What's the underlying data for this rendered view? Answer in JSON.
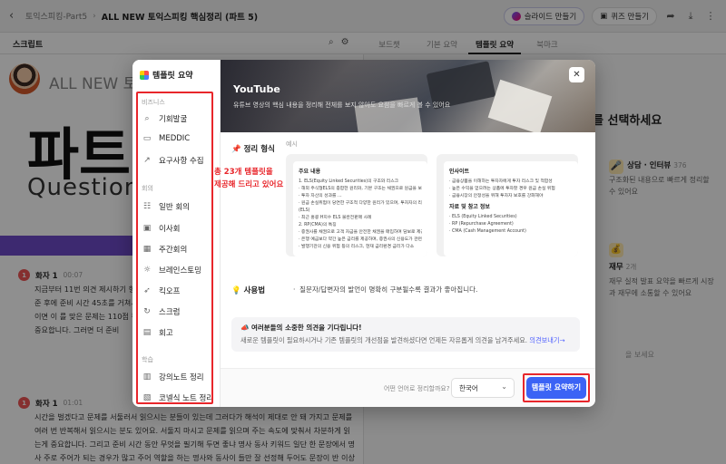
{
  "topbar": {
    "crumb": "토익스피킹-Part5",
    "title": "ALL NEW 토익스피킹 핵심정리 (파트 5)",
    "slide_btn": "슬라이드 만들기",
    "quiz_btn": "퀴즈 만들기"
  },
  "subbar": {
    "label": "스크립트",
    "tabs": [
      "보드챗",
      "기본 요약",
      "템플릿 요약",
      "북마크"
    ]
  },
  "left": {
    "hero_title": "ALL NEW 토익",
    "big_title": "파트",
    "subtitle": "Question",
    "blocks": [
      {
        "num": "1",
        "speaker": "화자 1",
        "time": "00:07",
        "text": "지금부터 11번 의견 제시하기 형식입니다. 이 문제는 간이 45초가 있고 답변 시간이 1분입니다. 45초가 준 후에 준비 시간 45초를 거쳐서 각을 잘 정해 나가셔야 돼요. 그러면 이하 이니면 내 실력이 130 이하이면 이 를 맞은 문제는 110점 뒤 100 과 문제를 준 그리고 주제가 문제가 집착 없이 곰히 해석하는게 중요합니다. 그러면 더 준비"
      },
      {
        "num": "1",
        "speaker": "화자 1",
        "time": "01:01",
        "text": "시간을 벌겠다고 문제를 서둘러서 읽으시는 분들이 있는데 그러다가 해석이 제대로 안 돼 가지고 문제를 여러 번 반복해서 읽으시는 분도 있어요. 서둘지 마시고 문제를 읽으며 주는 속도에 맞춰서 차분하게 읽는게 중요합니다. 그리고 준비 시간 동안 무엇을 필기해 두면 좋냐 명사 동사 키워드 일단 한 문장에서 명사 주로 주어가 되는 경우가 많고 주어 역할을 하는 명사와 동사이 들만 잘 선정해 두어도 문장이 반 이상은"
      }
    ]
  },
  "right": {
    "heading": "를 선택하세요",
    "cards": [
      {
        "icon": "🎤",
        "title": "상담 · 인터뷰",
        "count": "376",
        "desc": "구조화된 내용으로 빠르게 정리할 수 있어요"
      },
      {
        "icon": "💰",
        "title": "재무",
        "count": "2개",
        "desc": "재무 실적 발표 요약을 빠르게 시장과 재무에 소통할 수 있어요"
      }
    ],
    "bottom": "을 보세요"
  },
  "modal": {
    "title": "템플릿 요약",
    "sections": {
      "business": "비즈니스",
      "meeting": "회의",
      "study": "학습"
    },
    "items": {
      "business": [
        {
          "icon": "search-doc-icon",
          "glyph": "⌕",
          "label": "기회발굴"
        },
        {
          "icon": "bars-icon",
          "glyph": "▭",
          "label": "MEDDIC"
        },
        {
          "icon": "chart-icon",
          "glyph": "↗",
          "label": "요구사항 수집"
        }
      ],
      "meeting": [
        {
          "icon": "group-icon",
          "glyph": "☷",
          "label": "일반 회의"
        },
        {
          "icon": "board-icon",
          "glyph": "▣",
          "label": "이사회"
        },
        {
          "icon": "calendar-icon",
          "glyph": "▦",
          "label": "주간회의"
        },
        {
          "icon": "brain-icon",
          "glyph": "☼",
          "label": "브레인스토밍"
        },
        {
          "icon": "rocket-icon",
          "glyph": "➶",
          "label": "킥오프"
        },
        {
          "icon": "scrum-icon",
          "glyph": "↻",
          "label": "스크럼"
        },
        {
          "icon": "review-icon",
          "glyph": "▤",
          "label": "회고"
        }
      ],
      "study": [
        {
          "icon": "lecture-icon",
          "glyph": "▥",
          "label": "강의노트 정리"
        },
        {
          "icon": "cornell-icon",
          "glyph": "▧",
          "label": "코넬식 노트 정리"
        }
      ]
    },
    "banner": {
      "title": "YouTube",
      "desc": "유튜브 영상의 핵심 내용을 정리해 전체를 보지 않아도 요점을 빠르게 볼 수 있어요"
    },
    "format": {
      "label": "정리 형식",
      "example": "예시"
    },
    "samples": [
      {
        "heading": "주요 내용",
        "lines": [
          "1. ELS(Equity Linked Securities)의 구조와 리스크",
          "· 해외 주식형ELS의 종합한 원리와, 기본 구조는 채권으로 원금을 보장하고",
          "· 투자 자산의 성과를 …",
          "· 원금 손실위험이 당연한 구조적 다양한 원리가 있으며, 투자자의 리스",
          "  (ELS)",
          "· 최근 홍콩 H지수 ELS 불완전판매 사례",
          "2. RP(CMA)의 특징",
          "· 증권사를 채권으로 고객 자금을 안전한 채권을 매입하여 담보로 제공",
          "· 은행 예금보다 약간 높은 금리를 제공하며, 증권사의 신용도가 관련",
          "· 발행기관의 신용 위험 등의 리스크, 현재 금리환경 금리가 다소"
        ]
      },
      {
        "heading": "인사이트",
        "lines": [
          "· 금융상품을 이해하는 투자자에게 투자 리스크 및 적합성",
          "· 높은 수익을 얻으려는 상품에 투자할 경우 원금 손실 위험",
          "· 금융시장의 안정성을 위해 투자자 보호를 강화해야",
          "",
          "자료 및 참고 정보",
          "· ELS (Equity Linked Securities)",
          "· RP (Repurchase Agreement)",
          "· CMA (Cash Management Account)"
        ]
      }
    ],
    "usage": {
      "label": "사용법",
      "text": "질문자/답변자의 발언이 명확히 구분될수록 결과가 좋아집니다."
    },
    "feedback": {
      "title": "여러분들의 소중한 의견을 기다립니다!",
      "text": "새로운 템플릿이 필요하시거나 기존 템플릿의 개선점을 발견하셨다면 언제든 자유롭게 의견을 남겨주세요.",
      "link": "의견보내기→"
    },
    "footer": {
      "question": "어떤 언어로 정리할까요?",
      "language": "한국어",
      "submit": "템플릿 요약하기"
    }
  },
  "annotation": {
    "line1": "총 23개 템플릿을",
    "line2": "제공해 드리고 있어요"
  },
  "colors": {
    "accent": "#3b63f5",
    "highlight": "#e8262b",
    "band": "#6e49c8"
  }
}
